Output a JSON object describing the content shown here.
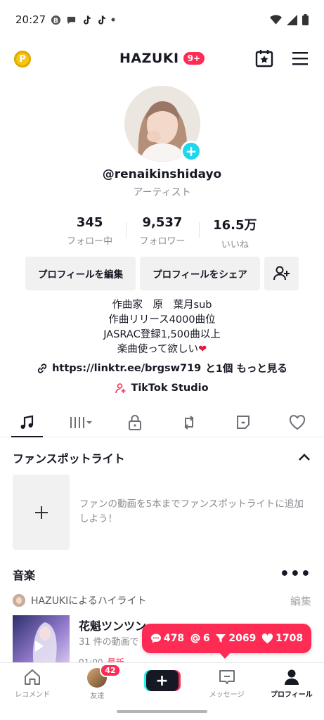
{
  "status_bar": {
    "time": "20:27",
    "icons": [
      "notification-b-icon",
      "chat-bubble-icon",
      "tiktok-icon",
      "tiktok-icon",
      "dot-icon",
      "wifi-icon",
      "signal-icon",
      "battery-icon"
    ]
  },
  "header": {
    "title": "HAZUKI",
    "badge": "9+",
    "coin_glyph": "P"
  },
  "profile": {
    "username": "@renaikinshidayo",
    "category": "アーティスト",
    "stats": [
      {
        "value": "345",
        "label": "フォロー中"
      },
      {
        "value": "9,537",
        "label": "フォロワー"
      },
      {
        "value": "16.5万",
        "label": "いいね"
      }
    ],
    "edit_label": "プロフィールを編集",
    "share_label": "プロフィールをシェア",
    "bio_lines": [
      "作曲家　原　葉月sub",
      "作曲リリース4000曲位",
      "JASRAC登録1,500曲以上",
      "楽曲使って欲しい"
    ],
    "bio_heart": "❤",
    "link": "https://linktr.ee/brgsw719",
    "link_extra": "と1個 もっと見る",
    "studio_label": "TikTok Studio"
  },
  "tabs": [
    "music-note-icon",
    "grid-dropdown-icon",
    "lock-icon",
    "repost-icon",
    "tag-eye-icon",
    "heart-outline-icon"
  ],
  "fan_spotlight": {
    "title": "ファンスポットライト",
    "description": "ファンの動画を5本までファンスポットライトに追加しよう！",
    "plus": "+"
  },
  "music": {
    "title": "音楽",
    "more": "•••",
    "highlight_label": "HAZUKIによるハイライト",
    "edit_label": "編集",
    "track_title": "花魁ツンツン",
    "track_sub": "31 件の動画で",
    "track_time": "01:00",
    "track_new": "最新"
  },
  "live_pill": {
    "comments": "478",
    "mentions": "6",
    "shares": "2069",
    "likes": "1708"
  },
  "bottom_nav": {
    "items": [
      {
        "label": "レコメンド"
      },
      {
        "label": "友達",
        "badge": "42"
      },
      {
        "label": ""
      },
      {
        "label": "メッセージ"
      },
      {
        "label": "プロフィール"
      }
    ],
    "create_glyph": "+"
  }
}
